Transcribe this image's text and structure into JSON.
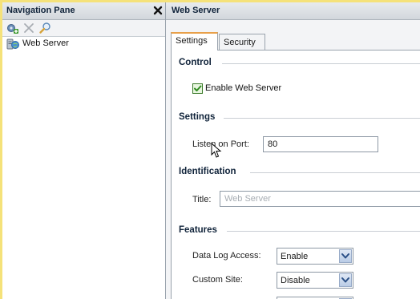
{
  "nav": {
    "title": "Navigation Pane",
    "toolbar_icons": [
      "add-server-icon",
      "delete-icon",
      "search-icon"
    ],
    "tree": [
      {
        "label": "Web Server",
        "icon": "web-server-icon"
      }
    ]
  },
  "main": {
    "title": "Web Server",
    "tabs": [
      {
        "label": "Settings",
        "active": true
      },
      {
        "label": "Security",
        "active": false
      }
    ],
    "sections": {
      "control": {
        "heading": "Control",
        "enable_web_server": {
          "label": "Enable Web Server",
          "checked": true
        }
      },
      "settings": {
        "heading": "Settings",
        "port_label": "Listen on Port:",
        "port_value": "80"
      },
      "identification": {
        "heading": "Identification",
        "title_label": "Title:",
        "title_placeholder": "Web Server"
      },
      "features": {
        "heading": "Features",
        "rows": [
          {
            "label": "Data Log Access:",
            "value": "Enable"
          },
          {
            "label": "Custom Site:",
            "value": "Disable"
          }
        ]
      }
    }
  },
  "colors": {
    "outer_border": "#f5e27a",
    "active_tab_accent": "#e8a04a",
    "header_text": "#10233a"
  }
}
